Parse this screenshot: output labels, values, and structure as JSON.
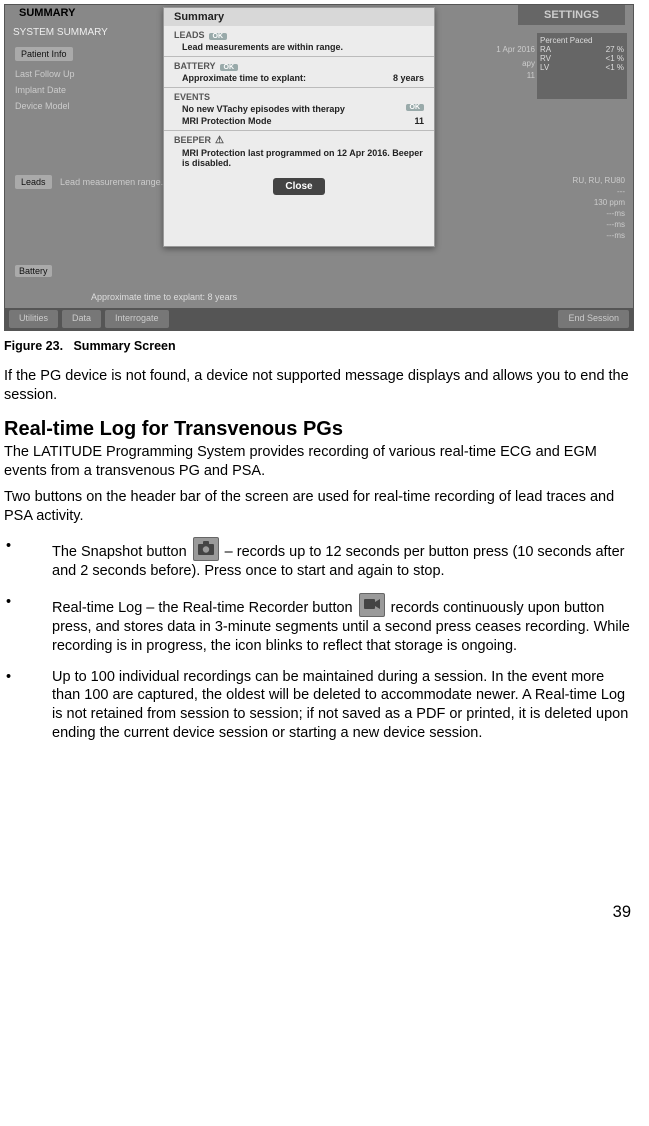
{
  "figure": {
    "tab_summary": "SUMMARY",
    "tab_settings": "SETTINGS",
    "system_summary": "SYSTEM SUMMARY",
    "patient_info_btn": "Patient Info",
    "last_follow_up": "Last Follow Up",
    "implant_date": "Implant Date",
    "device_model": "Device Model",
    "leads_label": "Leads",
    "leads_text_frag": "Lead measuremen range.",
    "battery_label": "Battery",
    "approx_explant": "Approximate time to explant:     8 years",
    "right_date": "1 Apr 2016",
    "right_apy": "apy",
    "right_apy_val": "11",
    "percent_paced": "Percent Paced",
    "pp": [
      {
        "k": "RA",
        "v": "27",
        "u": "%"
      },
      {
        "k": "RV",
        "v": "<1",
        "u": "%"
      },
      {
        "k": "LV",
        "v": "<1",
        "u": "%"
      }
    ],
    "right_low_hdr": "RU, RU, RU80",
    "right_low": [
      "---",
      "130   ppm",
      "---ms",
      "---ms",
      "---ms"
    ],
    "bottom": {
      "utilities": "Utilities",
      "data": "Data",
      "interrogate": "Interrogate",
      "end": "End Session"
    },
    "dialog": {
      "title": "Summary",
      "leads_hd": "LEADS",
      "leads_tx": "Lead measurements are within range.",
      "battery_hd": "BATTERY",
      "battery_tx": "Approximate time to explant:",
      "battery_val": "8 years",
      "events_hd": "EVENTS",
      "events_tx1": "No new VTachy episodes with therapy",
      "events_tx2": "MRI Protection Mode",
      "events_val2": "11",
      "beeper_hd": "BEEPER",
      "beeper_tx": "MRI Protection last programmed on 12 Apr 2016. Beeper is disabled.",
      "close": "Close"
    }
  },
  "figcaption_label": "Figure 23.",
  "figcaption_text": "Summary Screen",
  "para1": "If the PG device is not found, a device not supported message displays and allows you to end the session.",
  "heading": "Real-time Log for Transvenous PGs",
  "para2": "The LATITUDE Programming System provides recording of various real-time ECG and EGM events from a transvenous PG and PSA.",
  "para3": "Two buttons on the header bar of the screen are used for real-time recording of lead traces and PSA activity.",
  "bullets": {
    "b1_pre": "The Snapshot button ",
    "b1_post": " – records up to 12 seconds per button press (10 seconds after and 2 seconds before). Press once to start and again to stop.",
    "b2_pre": "Real-time Log – the Real-time Recorder button ",
    "b2_post": " records continuously upon button press, and stores data in 3-minute segments until a second press ceases recording. While recording is in progress, the icon blinks to reflect that storage is ongoing.",
    "b3": "Up to 100 individual recordings can be maintained during a session. In the event more than 100 are captured, the oldest will be deleted to accommodate newer. A Real-time Log is not retained from session to session; if not saved as a PDF or printed, it is deleted upon ending the current device session or starting a new device session."
  },
  "page_number": "39"
}
